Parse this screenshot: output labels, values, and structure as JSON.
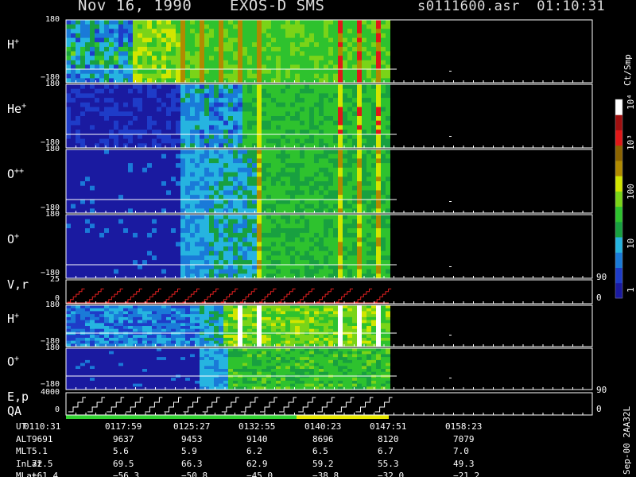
{
  "header": {
    "title_left": "Nov 16, 1990    EXOS-D SMS",
    "title_right": "s0111600.asr  01:10:31"
  },
  "colorbar": {
    "unit": "Ct/Smp",
    "ticks": [
      "1",
      "10",
      "100",
      "10³",
      "10⁴"
    ],
    "colors": [
      "#1a1aa0",
      "#1e3cc8",
      "#1a7ad8",
      "#26b4e0",
      "#18a040",
      "#2ec22e",
      "#7ad418",
      "#d2e600",
      "#b08a00",
      "#8c6400",
      "#e01818",
      "#a01010",
      "#ffffff"
    ]
  },
  "panels": [
    {
      "label": "H",
      "sup": "+",
      "ymax": "180",
      "ymin": "−180"
    },
    {
      "label": "He",
      "sup": "+",
      "ymax": "180",
      "ymin": "−180"
    },
    {
      "label": "O",
      "sup": "++",
      "ymax": "180",
      "ymin": "−180"
    },
    {
      "label": "O",
      "sup": "+",
      "ymax": "180",
      "ymin": "−180"
    },
    {
      "label": "V,r",
      "sup": "",
      "ymax": "25",
      "ymin": "0",
      "rmax": "90",
      "rmin": "0"
    },
    {
      "label": "H",
      "sup": "+",
      "ymax": "180",
      "ymin": "−180"
    },
    {
      "label": "O",
      "sup": "+",
      "ymax": "180",
      "ymin": "−180"
    },
    {
      "label": "E,p",
      "sup": "",
      "ymax": "4000",
      "ymin": "0",
      "rmax": "90",
      "rmin": "0"
    }
  ],
  "qa_label": "QA",
  "footer_id": "Sep-00 2AA32L",
  "chart_data": {
    "type": "heatmap",
    "title": "Nov 16, 1990 EXOS-D SMS",
    "x_ticks": [
      "0110:31",
      "0117:59",
      "0125:27",
      "0132:55",
      "0140:23",
      "0147:51",
      "0158:23"
    ],
    "data_end": "0147:51",
    "y_range": [
      -180,
      180
    ],
    "color_scale": "log",
    "color_range": [
      1,
      10000
    ],
    "colorbar_label": "Ct/Smp",
    "series": [
      {
        "name": "H+",
        "ylabel": "H+"
      },
      {
        "name": "He+",
        "ylabel": "He+"
      },
      {
        "name": "O++",
        "ylabel": "O++"
      },
      {
        "name": "O+",
        "ylabel": "O+"
      },
      {
        "name": "V,r",
        "ylabel": "V,r"
      },
      {
        "name": "H+",
        "ylabel": "H+"
      },
      {
        "name": "O+",
        "ylabel": "O+"
      },
      {
        "name": "E,p",
        "ylabel": "E,p"
      }
    ]
  },
  "ephemeris": {
    "rows": [
      {
        "name": "UT",
        "values": [
          "0110:31",
          "0117:59",
          "0125:27",
          "0132:55",
          "0140:23",
          "0147:51",
          "0158:23"
        ]
      },
      {
        "name": "ALT",
        "values": [
          "9691",
          "9637",
          "9453",
          "9140",
          "8696",
          "8120",
          "7079"
        ]
      },
      {
        "name": "MLT",
        "values": [
          "5.1",
          "5.6",
          "5.9",
          "6.2",
          "6.5",
          "6.7",
          "7.0"
        ]
      },
      {
        "name": "InLat",
        "values": [
          "72.5",
          "69.5",
          "66.3",
          "62.9",
          "59.2",
          "55.3",
          "49.3"
        ]
      },
      {
        "name": "MLat",
        "values": [
          "−61.4",
          "−56.3",
          "−50.8",
          "−45.0",
          "−38.8",
          "−32.0",
          "−21.2"
        ]
      }
    ]
  }
}
